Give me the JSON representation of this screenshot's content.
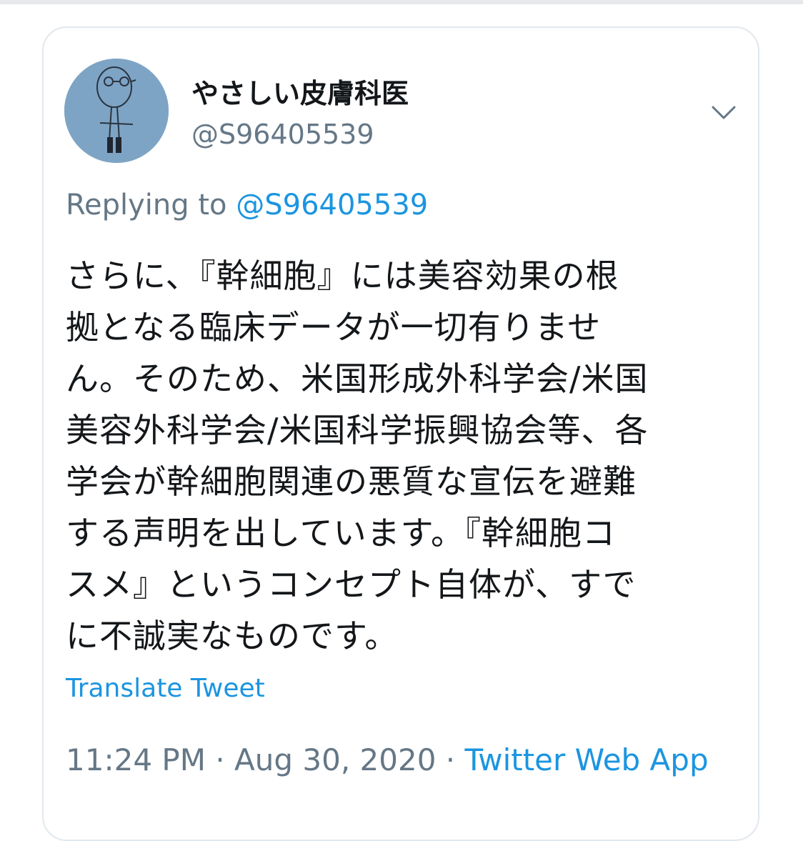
{
  "tweet": {
    "author": {
      "display_name": "やさしい皮膚科医",
      "handle": "@S96405539",
      "avatar_icon": "hand-drawn-figure-avatar"
    },
    "menu_icon": "chevron-down-icon",
    "reply": {
      "prefix": "Replying to",
      "target": "@S96405539"
    },
    "body_lines": [
      "さらに、『幹細胞』には美容効果の根",
      "拠となる臨床データが一切有りませ",
      "ん。そのため、米国形成外科学会/米国",
      "美容外科学会/米国科学振興協会等、各",
      "学会が幹細胞関連の悪質な宣伝を避難",
      "する声明を出しています。『幹細胞コ",
      "スメ』というコンセプト自体が、すで",
      "に不誠実なものです。"
    ],
    "translate_label": "Translate Tweet",
    "meta": {
      "time": "11:24 PM",
      "separator": "·",
      "date": "Aug 30, 2020",
      "app": "Twitter Web App"
    }
  },
  "colors": {
    "text": "#14171a",
    "secondary": "#657786",
    "link": "#1b95e0",
    "border": "#e1e8ed",
    "avatar_bg": "#7fa5c6"
  }
}
